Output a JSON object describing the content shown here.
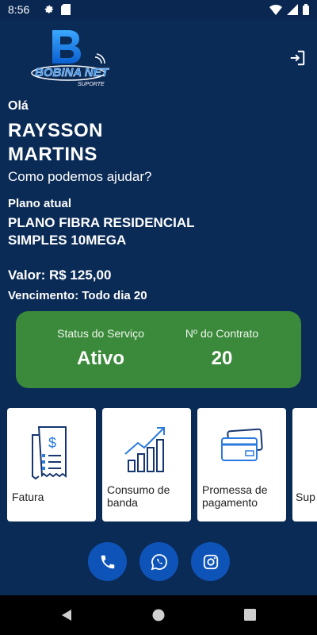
{
  "status_bar": {
    "time": "8:56",
    "icons": [
      "gear-icon",
      "sd-card-icon",
      "wifi-icon",
      "signal-icon",
      "battery-icon"
    ]
  },
  "logo": {
    "name": "BOBINA NET",
    "tagline": "SUPORTE"
  },
  "header": {
    "logout_icon": "logout-icon"
  },
  "user": {
    "greeting": "Olá",
    "name": "RAYSSON MARTINS",
    "help_text": "Como podemos ajudar?"
  },
  "plan": {
    "label": "Plano atual",
    "name": "PLANO FIBRA RESIDENCIAL SIMPLES 10MEGA",
    "value": "Valor: R$ 125,00",
    "due": "Vencimento: Todo dia 20"
  },
  "service": {
    "status_label": "Status do Serviço",
    "status_value": "Ativo",
    "contract_label": "Nº do Contrato",
    "contract_value": "20"
  },
  "actions": [
    {
      "label": "Fatura",
      "icon": "invoice-icon"
    },
    {
      "label": "Consumo de banda",
      "icon": "growth-chart-icon"
    },
    {
      "label": "Promessa de pagamento",
      "icon": "credit-cards-icon"
    },
    {
      "label": "Sup",
      "icon": ""
    }
  ],
  "social": [
    "phone-icon",
    "whatsapp-icon",
    "instagram-icon"
  ],
  "colors": {
    "background": "#0b2b57",
    "status_card": "#3b8a3b",
    "social_button": "#0e54b8",
    "icon_blue": "#16366f"
  }
}
